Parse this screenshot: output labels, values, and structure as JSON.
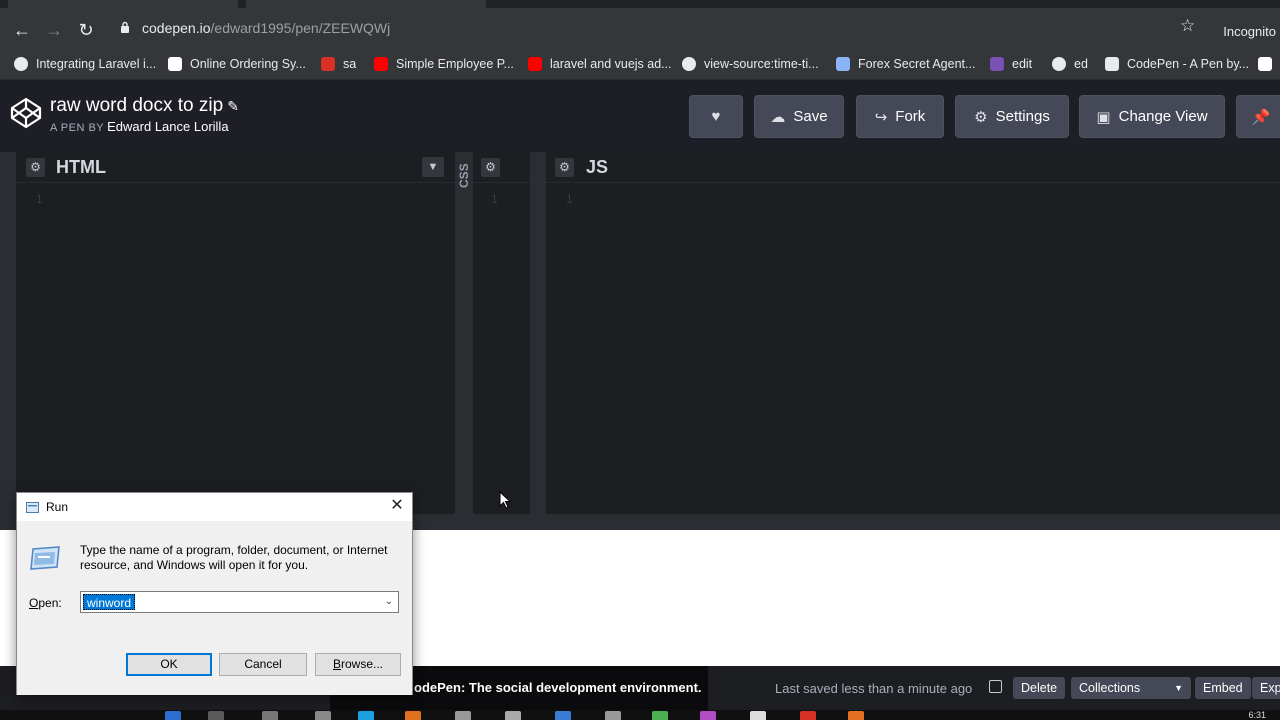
{
  "browser": {
    "url_host": "codepen.io",
    "url_path": "/edward1995/pen/ZEEWQWj",
    "incognito_label": "Incognito",
    "bookmarks": [
      {
        "label": "Integrating Laravel i...",
        "color": "#e8eaed"
      },
      {
        "label": "Online Ordering Sy...",
        "color": "#ffffff"
      },
      {
        "label": "sa",
        "color": "#d93025"
      },
      {
        "label": "Simple Employee P...",
        "color": "#ff0000"
      },
      {
        "label": "laravel and vuejs ad...",
        "color": "#ff0000"
      },
      {
        "label": "view-source:time-ti...",
        "color": "#e8eaed"
      },
      {
        "label": "Forex Secret Agent...",
        "color": "#8ab4f8"
      },
      {
        "label": "edit",
        "color": "#7952b3"
      },
      {
        "label": "ed",
        "color": "#e8eaed"
      },
      {
        "label": "CodePen - A Pen by...",
        "color": "#e8eaed"
      }
    ]
  },
  "pen": {
    "title": "raw word docx to zip",
    "by_label": "A PEN BY",
    "author": "Edward Lance Lorilla"
  },
  "toolbar": {
    "save_label": "Save",
    "fork_label": "Fork",
    "settings_label": "Settings",
    "change_view_label": "Change View"
  },
  "editors": {
    "html_label": "HTML",
    "css_label": "CSS",
    "js_label": "JS",
    "line_number": "1"
  },
  "footer": {
    "toast_text": "odePen: The social development environment.",
    "saved_text": "Last saved less than a minute ago",
    "delete_label": "Delete",
    "collections_label": "Collections",
    "embed_label": "Embed",
    "export_label": "Exp"
  },
  "taskbar": {
    "clock": "6:31"
  },
  "run_dialog": {
    "title": "Run",
    "description": "Type the name of a program, folder, document, or Internet resource, and Windows will open it for you.",
    "open_label": "Open:",
    "input_value": "winword",
    "ok_label": "OK",
    "cancel_label": "Cancel",
    "browse_label": "Browse..."
  },
  "colors": {
    "codepen_bg": "#1e1f26",
    "button_bg": "#444857",
    "selection_blue": "#0078d7"
  }
}
